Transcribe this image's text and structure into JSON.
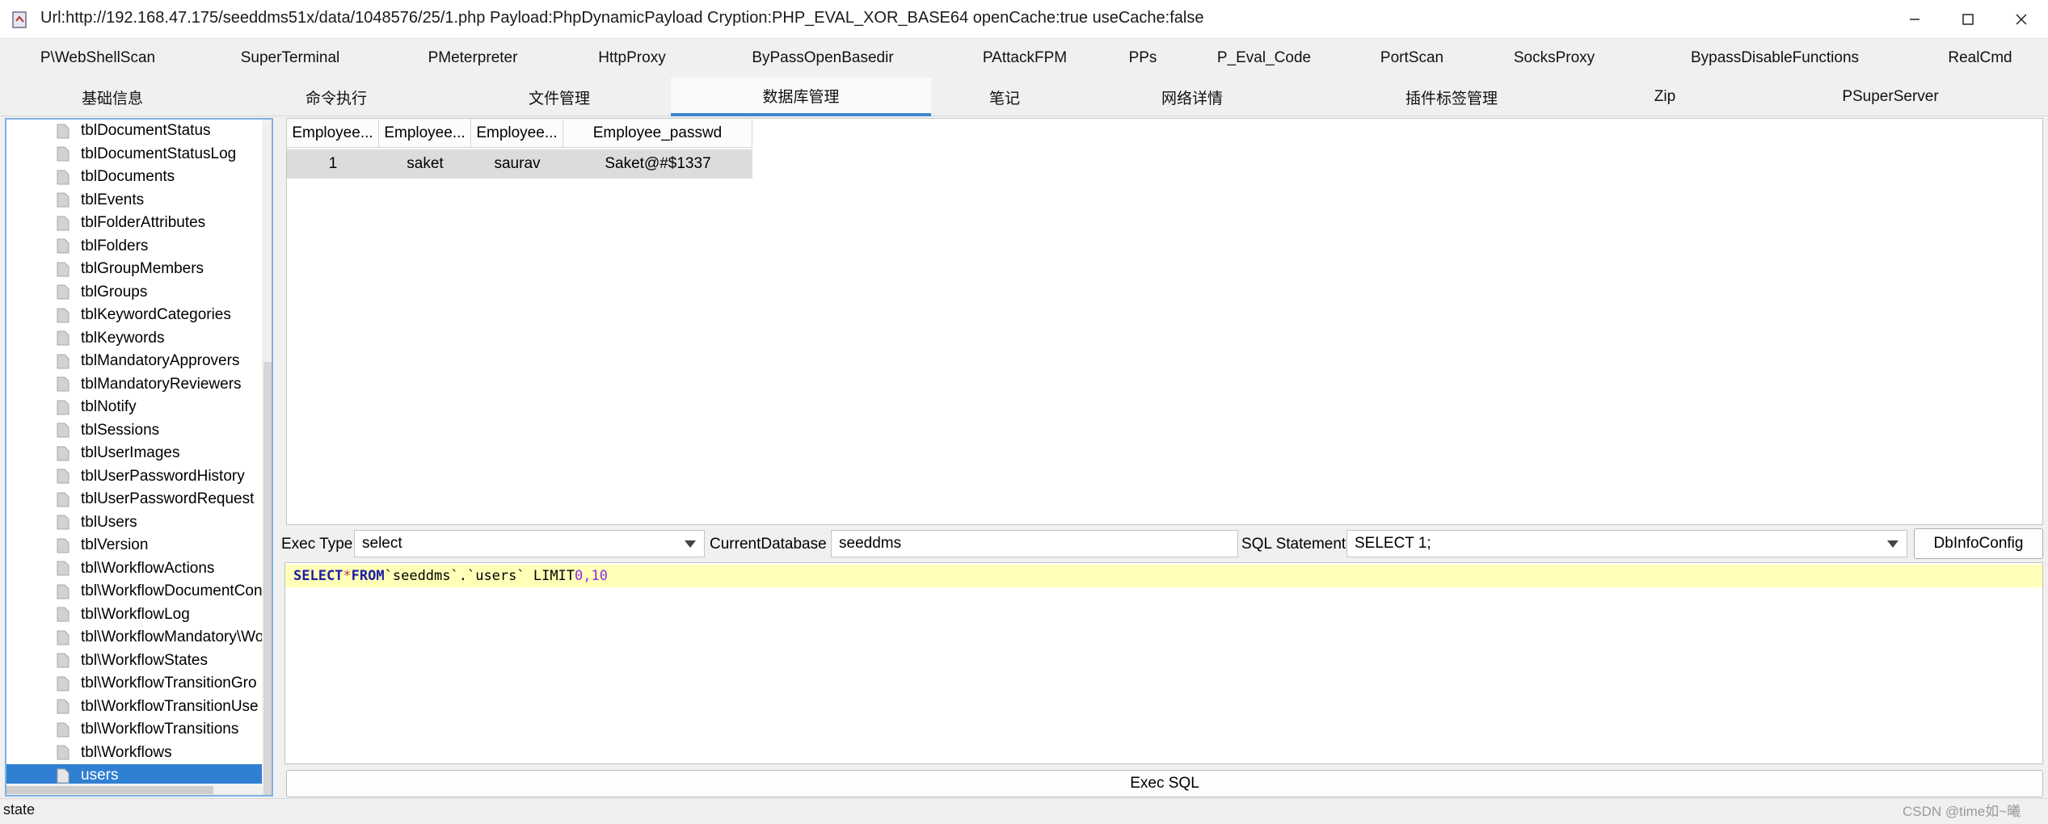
{
  "window": {
    "title": "Url:http://192.168.47.175/seeddms51x/data/1048576/25/1.php Payload:PhpDynamicPayload Cryption:PHP_EVAL_XOR_BASE64 openCache:true useCache:false"
  },
  "tabs_row1": [
    "P\\WebShellScan",
    "SuperTerminal",
    "PMeterpreter",
    "HttpProxy",
    "ByPassOpenBasedir",
    "PAttackFPM",
    "PPs",
    "P_Eval_Code",
    "PortScan",
    "SocksProxy",
    "BypassDisableFunctions",
    "RealCmd"
  ],
  "tabs_row2": [
    "基础信息",
    "命令执行",
    "文件管理",
    "数据库管理",
    "笔记",
    "网络详情",
    "插件标签管理",
    "Zip",
    "PSuperServer"
  ],
  "active_tab": "数据库管理",
  "tree": {
    "items": [
      "tblDocumentStatus",
      "tblDocumentStatusLog",
      "tblDocuments",
      "tblEvents",
      "tblFolderAttributes",
      "tblFolders",
      "tblGroupMembers",
      "tblGroups",
      "tblKeywordCategories",
      "tblKeywords",
      "tblMandatoryApprovers",
      "tblMandatoryReviewers",
      "tblNotify",
      "tblSessions",
      "tblUserImages",
      "tblUserPasswordHistory",
      "tblUserPasswordRequest",
      "tblUsers",
      "tblVersion",
      "tbl\\WorkflowActions",
      "tbl\\WorkflowDocumentCon",
      "tbl\\WorkflowLog",
      "tbl\\WorkflowMandatory\\Wo",
      "tbl\\WorkflowStates",
      "tbl\\WorkflowTransitionGro",
      "tbl\\WorkflowTransitionUse",
      "tbl\\WorkflowTransitions",
      "tbl\\Workflows",
      "users"
    ],
    "selected": "users"
  },
  "result_table": {
    "columns": [
      "Employee...",
      "Employee...",
      "Employee...",
      "Employee_passwd"
    ],
    "rows": [
      [
        "1",
        "saket",
        "saurav",
        "Saket@#$1337"
      ]
    ]
  },
  "controls": {
    "exec_type_label": "Exec Type",
    "exec_type_value": "select",
    "current_db_label": "CurrentDatabase",
    "current_db_value": "seeddms",
    "sql_statement_label": "SQL Statement",
    "sql_statement_value": "SELECT 1;",
    "dbinfo_button": "DbInfoConfig",
    "exec_button": "Exec SQL"
  },
  "editor": {
    "kw1": "SELECT",
    "star": "*",
    "kw2": "FROM",
    "rest": "`seeddms`.`users` LIMIT",
    "num": "0,10"
  },
  "status": "state",
  "watermark": "CSDN @time如~曦"
}
